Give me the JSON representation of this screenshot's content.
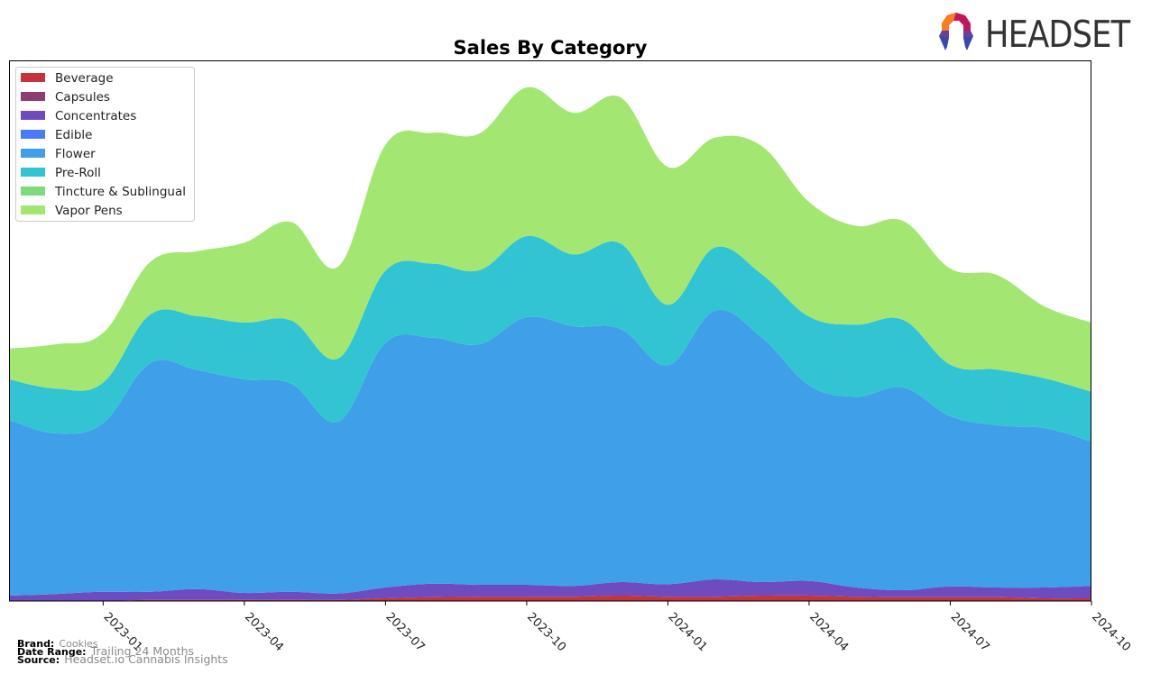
{
  "logo": {
    "text": "HEADSET",
    "colors": [
      "#f57f22",
      "#c2185b",
      "#8e24aa",
      "#3949ab"
    ]
  },
  "footer": {
    "brand_label": "Brand:",
    "brand_value": "Cookies",
    "date_range_label": "Date Range:",
    "date_range_value": "Trailing 24 Months",
    "source_label": "Source:",
    "source_value": "Headset.io Cannabis Insights"
  },
  "chart_data": {
    "type": "area",
    "stacked": true,
    "title": "Sales By Category",
    "xlabel": "",
    "ylabel": "",
    "y_axis_visible": false,
    "grid": false,
    "legend_position": "top-left",
    "x": [
      "2022-11",
      "2022-12",
      "2023-01",
      "2023-02",
      "2023-03",
      "2023-04",
      "2023-05",
      "2023-06",
      "2023-07",
      "2023-08",
      "2023-09",
      "2023-10",
      "2023-11",
      "2023-12",
      "2024-01",
      "2024-02",
      "2024-03",
      "2024-04",
      "2024-05",
      "2024-06",
      "2024-07",
      "2024-08",
      "2024-09",
      "2024-10"
    ],
    "x_ticks": [
      "2023-01",
      "2023-04",
      "2023-07",
      "2023-10",
      "2024-01",
      "2024-04",
      "2024-07",
      "2024-10"
    ],
    "ylim": [
      0,
      100
    ],
    "series": [
      {
        "name": "Beverage",
        "color": "#c4343a",
        "values": [
          0.0,
          0.0,
          0.0,
          0.2,
          0.2,
          0.2,
          0.2,
          0.2,
          0.5,
          0.7,
          0.8,
          0.8,
          0.8,
          1.0,
          0.8,
          0.8,
          1.0,
          1.0,
          0.8,
          0.7,
          0.7,
          0.7,
          0.5,
          0.5
        ]
      },
      {
        "name": "Capsules",
        "color": "#8e3b76",
        "values": [
          0.0,
          0.0,
          0.0,
          0.0,
          0.0,
          0.0,
          0.0,
          0.0,
          0.0,
          0.0,
          0.0,
          0.0,
          0.0,
          0.0,
          0.0,
          0.0,
          0.0,
          0.0,
          0.0,
          0.0,
          0.0,
          0.0,
          0.0,
          0.0
        ]
      },
      {
        "name": "Concentrates",
        "color": "#6e4bbf",
        "values": [
          1.0,
          1.3,
          1.7,
          1.5,
          2.0,
          1.3,
          1.5,
          1.2,
          2.0,
          2.5,
          2.2,
          2.2,
          2.0,
          2.5,
          2.3,
          3.2,
          2.5,
          2.7,
          1.7,
          1.3,
          2.0,
          1.8,
          2.0,
          2.3
        ]
      },
      {
        "name": "Edible",
        "color": "#4a7cf7",
        "values": [
          0.0,
          0.0,
          0.0,
          0.0,
          0.0,
          0.0,
          0.0,
          0.0,
          0.0,
          0.0,
          0.0,
          0.0,
          0.0,
          0.0,
          0.0,
          0.0,
          0.0,
          0.0,
          0.0,
          0.0,
          0.0,
          0.0,
          0.0,
          0.0
        ]
      },
      {
        "name": "Flower",
        "color": "#3f9fe8",
        "values": [
          32.5,
          29.7,
          31.2,
          42.3,
          40.5,
          39.5,
          38.5,
          31.8,
          45.3,
          45.5,
          44.5,
          49.5,
          48.0,
          46.8,
          40.5,
          49.7,
          45.2,
          36.2,
          35.3,
          37.5,
          31.5,
          30.0,
          29.5,
          26.7
        ]
      },
      {
        "name": "Pre-Roll",
        "color": "#33c4d4",
        "values": [
          7.5,
          8.3,
          7.5,
          9.0,
          10.0,
          10.5,
          11.7,
          11.7,
          13.3,
          13.7,
          13.7,
          15.0,
          13.3,
          15.8,
          11.2,
          11.7,
          11.7,
          12.7,
          13.3,
          12.5,
          9.5,
          10.3,
          9.2,
          9.2
        ]
      },
      {
        "name": "Tincture & Sublingual",
        "color": "#7ddb7c",
        "values": [
          0.0,
          0.0,
          0.0,
          0.0,
          0.0,
          0.0,
          0.0,
          0.0,
          0.0,
          0.0,
          0.0,
          0.0,
          0.0,
          0.0,
          0.0,
          0.0,
          0.0,
          0.0,
          0.0,
          0.0,
          0.0,
          0.0,
          0.0,
          0.0
        ]
      },
      {
        "name": "Vapor Pens",
        "color": "#a3e672",
        "values": [
          5.7,
          8.2,
          9.2,
          9.7,
          12.0,
          14.8,
          18.2,
          17.0,
          23.3,
          24.2,
          25.3,
          27.5,
          26.2,
          27.0,
          25.5,
          20.3,
          23.7,
          21.2,
          18.3,
          18.3,
          17.8,
          17.5,
          13.3,
          12.8
        ]
      }
    ]
  }
}
